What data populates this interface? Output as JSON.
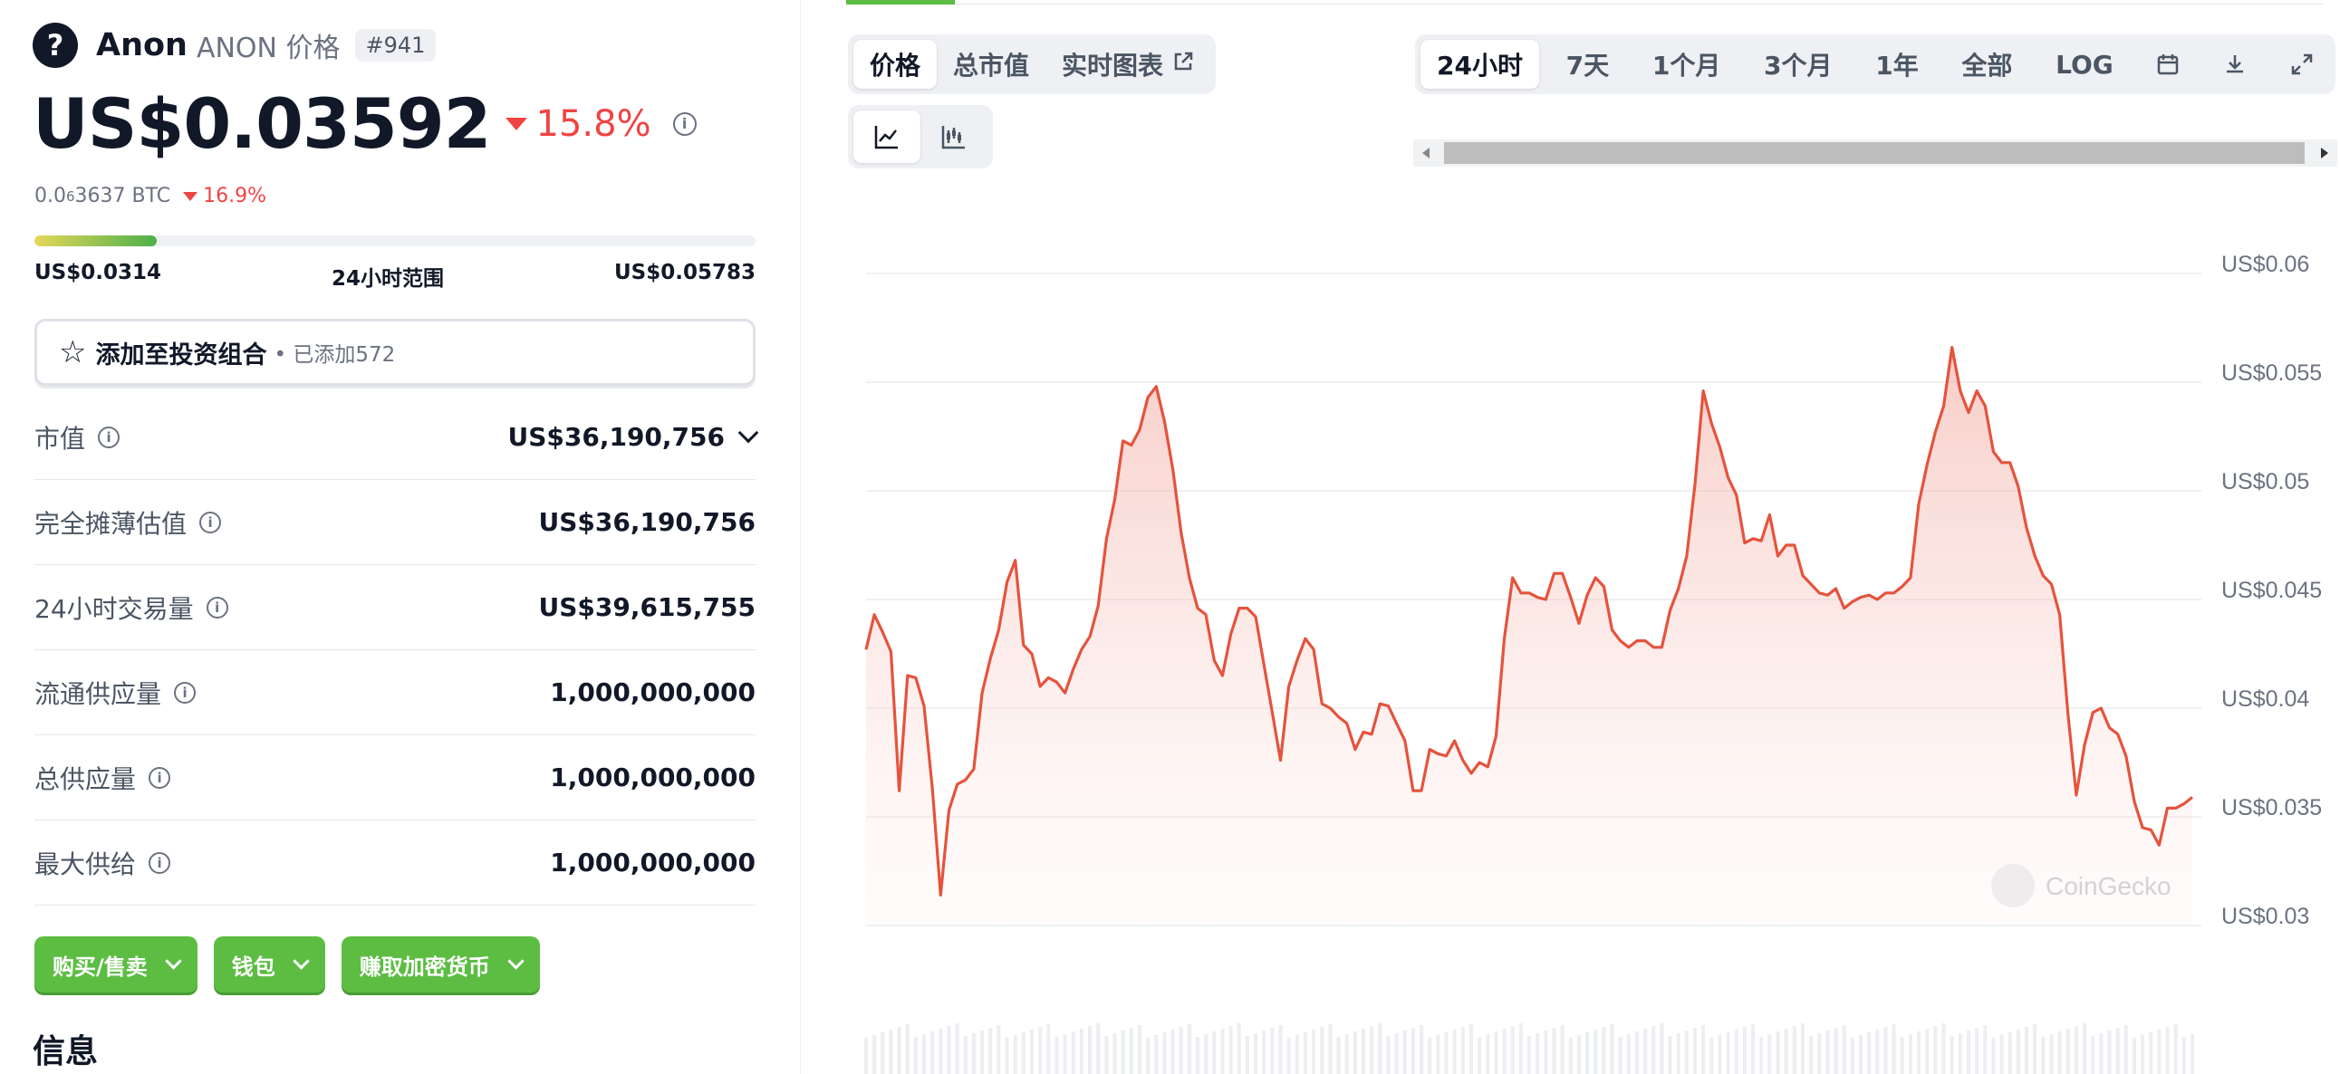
{
  "coin": {
    "name": "Anon",
    "symbol_label": "ANON 价格",
    "rank": "#941",
    "logo_glyph": "?",
    "price": "US$0.03592",
    "change_24h": "15.8%",
    "btc_prefix": "0.0",
    "btc_sub": "6",
    "btc_rest": "3637 BTC",
    "btc_change": "16.9%",
    "range_position": 0.17
  },
  "range": {
    "low": "US$0.0314",
    "label": "24小时范围",
    "high": "US$0.05783"
  },
  "portfolio": {
    "label": "添加至投资组合",
    "added": "• 已添加572"
  },
  "stats": [
    {
      "label": "市值",
      "value": "US$36,190,756"
    },
    {
      "label": "完全摊薄估值",
      "value": "US$36,190,756"
    },
    {
      "label": "24小时交易量",
      "value": "US$39,615,755"
    },
    {
      "label": "流通供应量",
      "value": "1,000,000,000"
    },
    {
      "label": "总供应量",
      "value": "1,000,000,000"
    },
    {
      "label": "最大供给",
      "value": "1,000,000,000"
    }
  ],
  "actions": {
    "buy_sell": "购买/售卖",
    "wallet": "钱包",
    "earn": "赚取加密货币"
  },
  "section_title": "信息",
  "chart_tabs": {
    "price": "价格",
    "market_cap": "总市值",
    "live_chart": "实时图表"
  },
  "time_ranges": [
    "24小时",
    "7天",
    "1个月",
    "3个月",
    "1年",
    "全部",
    "LOG"
  ],
  "chart_icons": [
    "calendar-icon",
    "download-icon",
    "fullscreen-icon"
  ],
  "chart_style_icons": [
    "line-chart-icon",
    "candlestick-icon"
  ],
  "colors": {
    "accent_green": "#5cbd42",
    "down_red": "#ef4444",
    "line": "#e5533d"
  },
  "chart_data": {
    "type": "area",
    "x_range": "24小时",
    "ylim": [
      0.03,
      0.06
    ],
    "y_ticks": [
      0.06,
      0.055,
      0.05,
      0.045,
      0.04,
      0.035,
      0.03
    ],
    "y_tick_labels": [
      "US$0.06",
      "US$0.055",
      "US$0.05",
      "US$0.045",
      "US$0.04",
      "US$0.035",
      "US$0.03"
    ],
    "watermark": "CoinGecko",
    "values": [
      0.0427,
      0.0443,
      0.0435,
      0.0426,
      0.0362,
      0.0415,
      0.0414,
      0.0401,
      0.0363,
      0.0314,
      0.0353,
      0.0365,
      0.0367,
      0.0372,
      0.0407,
      0.0423,
      0.0436,
      0.0458,
      0.0468,
      0.0429,
      0.0425,
      0.041,
      0.0414,
      0.0412,
      0.0407,
      0.0418,
      0.0427,
      0.0433,
      0.0447,
      0.0478,
      0.0496,
      0.0523,
      0.0521,
      0.0528,
      0.0543,
      0.0548,
      0.0532,
      0.051,
      0.0481,
      0.046,
      0.0446,
      0.0443,
      0.0422,
      0.0415,
      0.0434,
      0.0446,
      0.0446,
      0.0442,
      0.042,
      0.0398,
      0.0376,
      0.041,
      0.0422,
      0.0432,
      0.0427,
      0.0402,
      0.04,
      0.0396,
      0.0393,
      0.0381,
      0.0389,
      0.0388,
      0.0402,
      0.0401,
      0.0393,
      0.0385,
      0.0362,
      0.0362,
      0.0381,
      0.0379,
      0.0378,
      0.0385,
      0.0376,
      0.037,
      0.0375,
      0.0373,
      0.0387,
      0.0432,
      0.046,
      0.0453,
      0.0453,
      0.0451,
      0.045,
      0.0462,
      0.0462,
      0.0451,
      0.0439,
      0.0452,
      0.046,
      0.0456,
      0.0436,
      0.0431,
      0.0428,
      0.0431,
      0.0431,
      0.0428,
      0.0428,
      0.0445,
      0.0455,
      0.047,
      0.0503,
      0.0546,
      0.0531,
      0.052,
      0.0506,
      0.0498,
      0.0476,
      0.0478,
      0.0477,
      0.0489,
      0.047,
      0.0475,
      0.0475,
      0.0461,
      0.0457,
      0.0453,
      0.0452,
      0.0455,
      0.0446,
      0.0449,
      0.0451,
      0.0452,
      0.045,
      0.0453,
      0.0453,
      0.0456,
      0.046,
      0.0494,
      0.0512,
      0.0527,
      0.0539,
      0.0566,
      0.0546,
      0.0536,
      0.0546,
      0.0539,
      0.0518,
      0.0513,
      0.0513,
      0.0502,
      0.0483,
      0.047,
      0.0461,
      0.0457,
      0.0443,
      0.0397,
      0.036,
      0.0383,
      0.0398,
      0.04,
      0.0391,
      0.0388,
      0.0378,
      0.0357,
      0.0345,
      0.0344,
      0.0337,
      0.0354,
      0.0354,
      0.0356,
      0.0359
    ]
  }
}
